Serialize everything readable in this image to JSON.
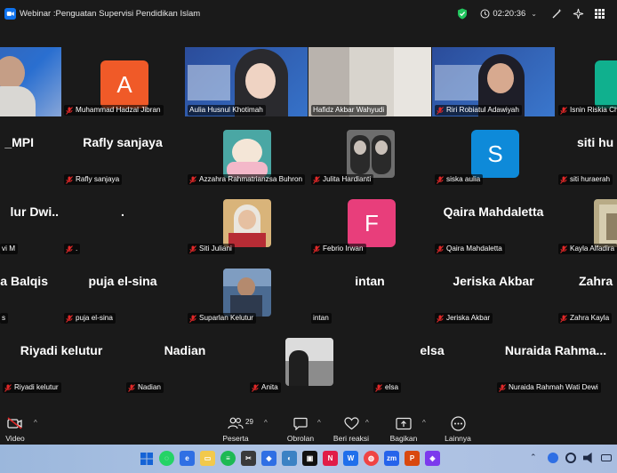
{
  "window": {
    "title": "Webinar :Penguatan Supervisi Pendidikan Islam",
    "timer": "02:20:36"
  },
  "tiles": {
    "r1_0": {
      "name": ""
    },
    "r1_1": {
      "name": "Muhammad Hadzal Jibran",
      "initial": "A",
      "color": "#f05a28"
    },
    "r1_2": {
      "name": "Aulia Husnul Khotimah"
    },
    "r1_3": {
      "name": "Hafidz Akbar Wahyudi"
    },
    "r1_4": {
      "name": "Riri Robiatul Adawiyah"
    },
    "r1_5": {
      "name": "Isnin Riskia Ch"
    },
    "r2_0": {
      "big": "_MPI",
      "name": ""
    },
    "r2_1": {
      "big": "Rafly sanjaya",
      "name": "Rafly sanjaya"
    },
    "r2_2": {
      "name": "Azzahra Rahmatrianzsa Buhron"
    },
    "r2_3": {
      "name": "Julita Hardianti"
    },
    "r2_4": {
      "name": "siska aulia",
      "initial": "S",
      "color": "#0e8ad9"
    },
    "r2_5": {
      "big": "siti hu",
      "name": "siti huraerah"
    },
    "r3_0": {
      "big": "lur Dwi..",
      "name": "vi M"
    },
    "r3_1": {
      "big": ".",
      "name": "."
    },
    "r3_2": {
      "name": "Siti Juliani"
    },
    "r3_3": {
      "name": "Febrio Irwan",
      "initial": "F",
      "color": "#e83e7b"
    },
    "r3_4": {
      "big": "Qaira Mahdaletta",
      "name": "Qaira Mahdaletta"
    },
    "r3_5": {
      "name": "Kayla Alfadira"
    },
    "r4_0": {
      "big": "a Balqis",
      "name": "s"
    },
    "r4_1": {
      "big": "puja el-sina",
      "name": "puja el-sina"
    },
    "r4_2": {
      "name": "Suparlan Kelutur"
    },
    "r4_3": {
      "big": "intan",
      "name": "intan"
    },
    "r4_4": {
      "big": "Jeriska Akbar",
      "name": "Jeriska Akbar"
    },
    "r4_5": {
      "big": "Zahra",
      "name": "Zahra Kayla"
    },
    "r5_0": {
      "big": "Riyadi kelutur",
      "name": "Riyadi kelutur"
    },
    "r5_1": {
      "big": "Nadian",
      "name": "Nadian"
    },
    "r5_2": {
      "name": "Anita"
    },
    "r5_3": {
      "big": "elsa",
      "name": "elsa"
    },
    "r5_4": {
      "big": "Nuraida Rahma...",
      "name": "Nuraida Rahmah Wati Dewi"
    }
  },
  "toolbar": {
    "video": "Video",
    "participants": "Peserta",
    "participants_count": "29",
    "chat": "Obrolan",
    "react": "Beri reaksi",
    "share": "Bagikan",
    "more": "Lainnya"
  },
  "colors": {
    "accent": "#0e72ed",
    "spotlight": "#22c55e",
    "shield": "#22c55e"
  }
}
